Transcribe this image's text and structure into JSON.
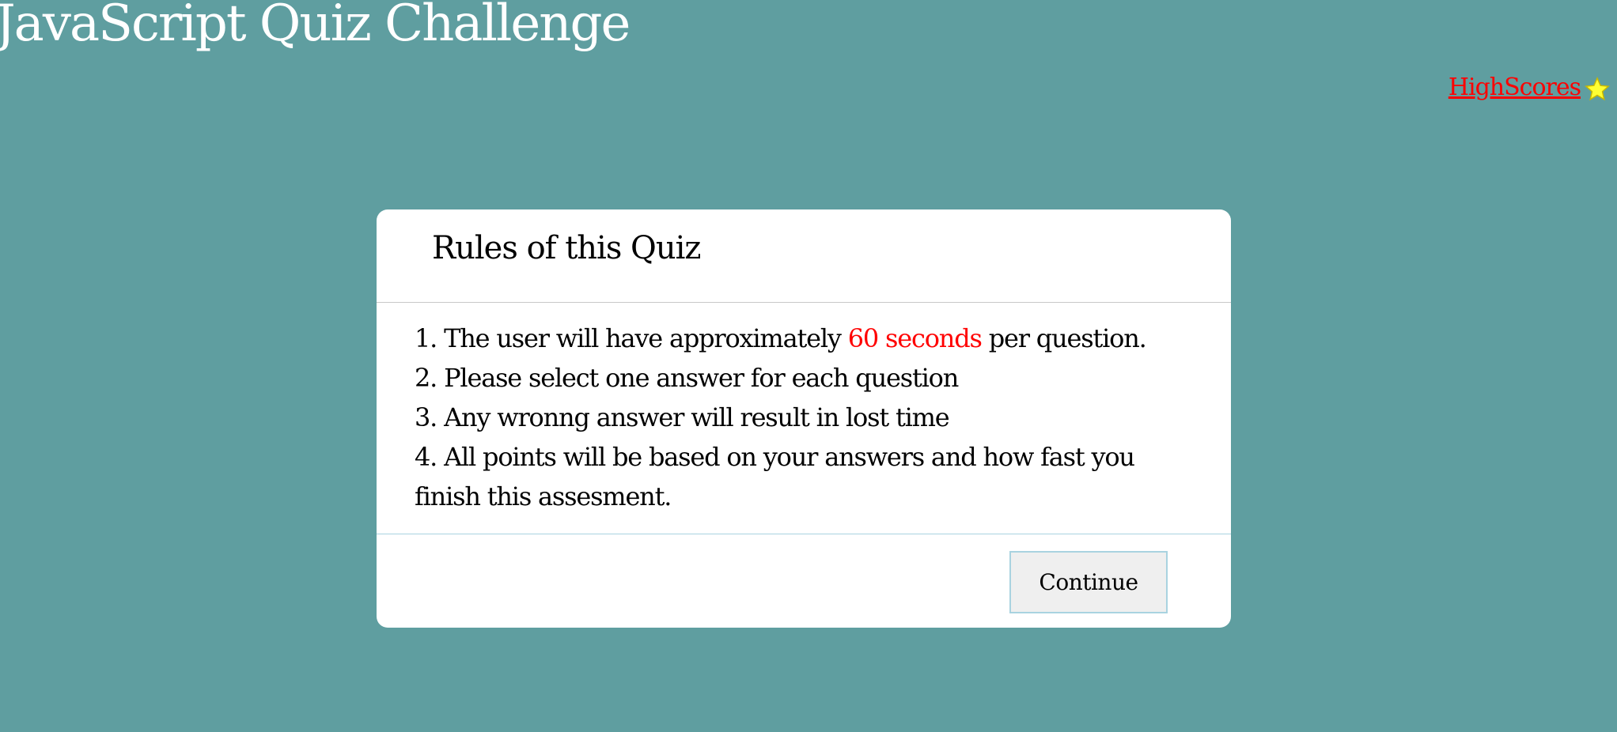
{
  "app": {
    "title": "JavaScript Quiz Challenge"
  },
  "nav": {
    "highscores_label": "HighScores",
    "highscores_icon": "star-icon"
  },
  "modal": {
    "title": "Rules of this Quiz",
    "rules": [
      {
        "prefix": "1. The user will have approximately ",
        "highlight": "60 seconds",
        "suffix": " per question."
      },
      {
        "text": "2. Please select one answer for each question"
      },
      {
        "text": "3. Any wronng answer will result in lost time"
      },
      {
        "text": "4. All points will be based on your answers and how fast you finish this assesment."
      }
    ],
    "continue_label": "Continue"
  },
  "colors": {
    "background": "#5f9ea0",
    "link": "#ff0000",
    "highlight": "#ff0000",
    "star": "#ffff33",
    "button_border": "#a9d3e0"
  }
}
